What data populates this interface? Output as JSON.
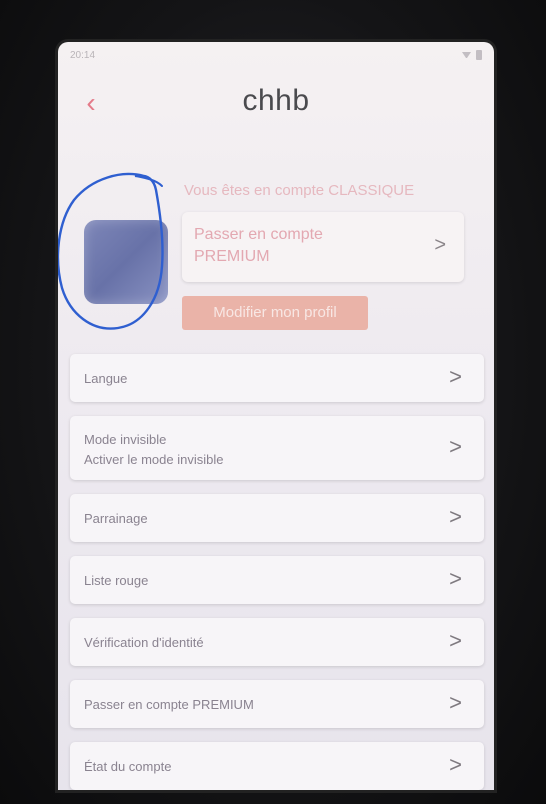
{
  "status_bar": {
    "time": "20:14"
  },
  "header": {
    "title": "chhb",
    "back_glyph": "‹"
  },
  "profile": {
    "account_type": "Vous êtes en compte CLASSIQUE",
    "premium_card_label": "Passer en compte PREMIUM",
    "premium_card_chevron": ">",
    "edit_profile_label": "Modifier mon profil"
  },
  "settings": {
    "items": [
      {
        "label": "Langue",
        "chevron": ">"
      },
      {
        "label": "Mode invisible",
        "sublabel": "Activer le mode invisible",
        "chevron": ">"
      },
      {
        "label": "Parrainage",
        "chevron": ">"
      },
      {
        "label": "Liste rouge",
        "chevron": ">"
      },
      {
        "label": "Vérification d'identité",
        "chevron": ">"
      },
      {
        "label": "Passer en compte PREMIUM",
        "chevron": ">"
      },
      {
        "label": "État du compte",
        "chevron": ">"
      }
    ]
  },
  "colors": {
    "accent": "#e47b8a",
    "button": "#eab3a8",
    "avatar": "#7d86b8",
    "scribble": "#2f5fd0"
  }
}
